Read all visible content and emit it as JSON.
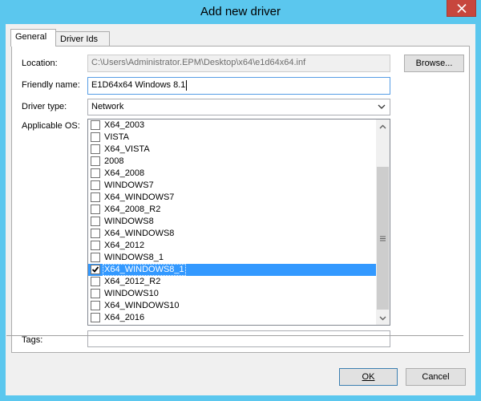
{
  "window": {
    "title": "Add new driver"
  },
  "tabs": [
    {
      "label": "General",
      "active": true
    },
    {
      "label": "Driver Ids",
      "active": false
    }
  ],
  "form": {
    "location_label": "Location:",
    "location_value": "C:\\Users\\Administrator.EPM\\Desktop\\x64\\e1d64x64.inf",
    "browse_label": "Browse...",
    "friendly_name_label": "Friendly name:",
    "friendly_name_value": "E1D64x64 Windows 8.1",
    "driver_type_label": "Driver type:",
    "driver_type_value": "Network",
    "applicable_os_label": "Applicable OS:",
    "tags_label": "Tags:",
    "tags_value": ""
  },
  "os_list": [
    {
      "name": "X64_2003",
      "checked": false,
      "selected": false
    },
    {
      "name": "VISTA",
      "checked": false,
      "selected": false
    },
    {
      "name": "X64_VISTA",
      "checked": false,
      "selected": false
    },
    {
      "name": "2008",
      "checked": false,
      "selected": false
    },
    {
      "name": "X64_2008",
      "checked": false,
      "selected": false
    },
    {
      "name": "WINDOWS7",
      "checked": false,
      "selected": false
    },
    {
      "name": "X64_WINDOWS7",
      "checked": false,
      "selected": false
    },
    {
      "name": "X64_2008_R2",
      "checked": false,
      "selected": false
    },
    {
      "name": "WINDOWS8",
      "checked": false,
      "selected": false
    },
    {
      "name": "X64_WINDOWS8",
      "checked": false,
      "selected": false
    },
    {
      "name": "X64_2012",
      "checked": false,
      "selected": false
    },
    {
      "name": "WINDOWS8_1",
      "checked": false,
      "selected": false
    },
    {
      "name": "X64_WINDOWS8_1",
      "checked": true,
      "selected": true
    },
    {
      "name": "X64_2012_R2",
      "checked": false,
      "selected": false
    },
    {
      "name": "WINDOWS10",
      "checked": false,
      "selected": false
    },
    {
      "name": "X64_WINDOWS10",
      "checked": false,
      "selected": false
    },
    {
      "name": "X64_2016",
      "checked": false,
      "selected": false
    }
  ],
  "buttons": {
    "ok_label": "OK",
    "cancel_label": "Cancel"
  },
  "colors": {
    "title_bar": "#5bc7ee",
    "close_button": "#c7463d",
    "selection": "#3399ff"
  }
}
